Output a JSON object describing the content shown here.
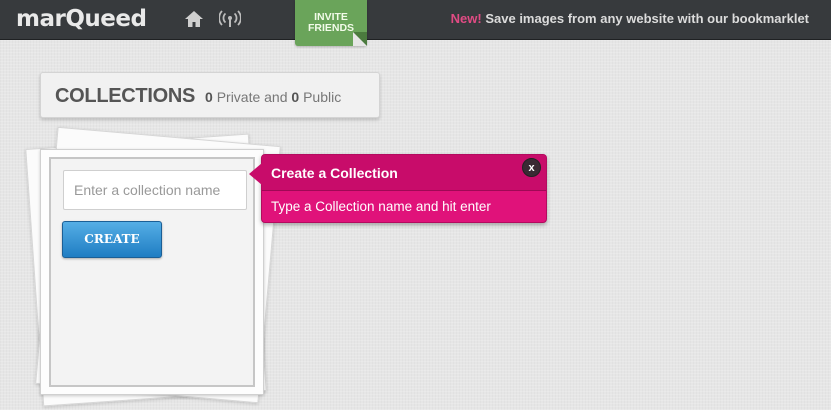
{
  "header": {
    "logo_text": "marQueed",
    "invite_label_line1": "INVITE",
    "invite_label_line2": "FRIENDS",
    "announcement_new": "New!",
    "announcement_text": "Save images from any website with our bookmarklet",
    "icons": [
      "home-icon",
      "signal-icon"
    ]
  },
  "collections": {
    "title": "COLLECTIONS",
    "private_count": "0",
    "private_label": "Private and",
    "public_count": "0",
    "public_label": "Public"
  },
  "create_form": {
    "input_placeholder": "Enter a collection name",
    "input_value": "",
    "button_label": "CREATE"
  },
  "tooltip": {
    "title": "Create a Collection",
    "body": "Type a Collection name and hit enter",
    "close_label": "x"
  },
  "colors": {
    "topbar": "#373a3d",
    "invite_green": "#6aa45a",
    "new_pink": "#e14b84",
    "tooltip_magenta": "#e0127a",
    "button_blue": "#1f7dc3"
  }
}
